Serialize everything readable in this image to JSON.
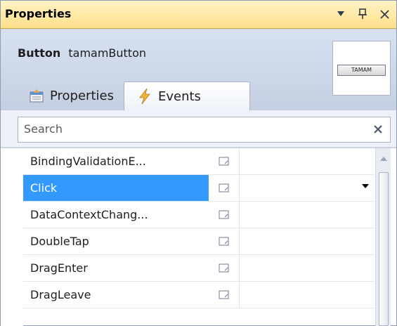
{
  "window": {
    "title": "Properties",
    "buttons": [
      "dropdown-icon",
      "pin-icon",
      "close-icon"
    ]
  },
  "object": {
    "type": "Button",
    "name": "tamamButton",
    "preview_label": "TAMAM"
  },
  "tabs": [
    {
      "label": "Properties",
      "icon": "properties-icon",
      "active": false
    },
    {
      "label": "Events",
      "icon": "lightning-icon",
      "active": true
    }
  ],
  "search": {
    "placeholder": "Search",
    "value": ""
  },
  "events": [
    {
      "name": "BindingValidationE...",
      "selected": false
    },
    {
      "name": "Click",
      "selected": true
    },
    {
      "name": "DataContextChang...",
      "selected": false
    },
    {
      "name": "DoubleTap",
      "selected": false
    },
    {
      "name": "DragEnter",
      "selected": false
    },
    {
      "name": "DragLeave",
      "selected": false
    }
  ],
  "colors": {
    "selection": "#3399ff",
    "title_bar": "#ffe08a"
  }
}
